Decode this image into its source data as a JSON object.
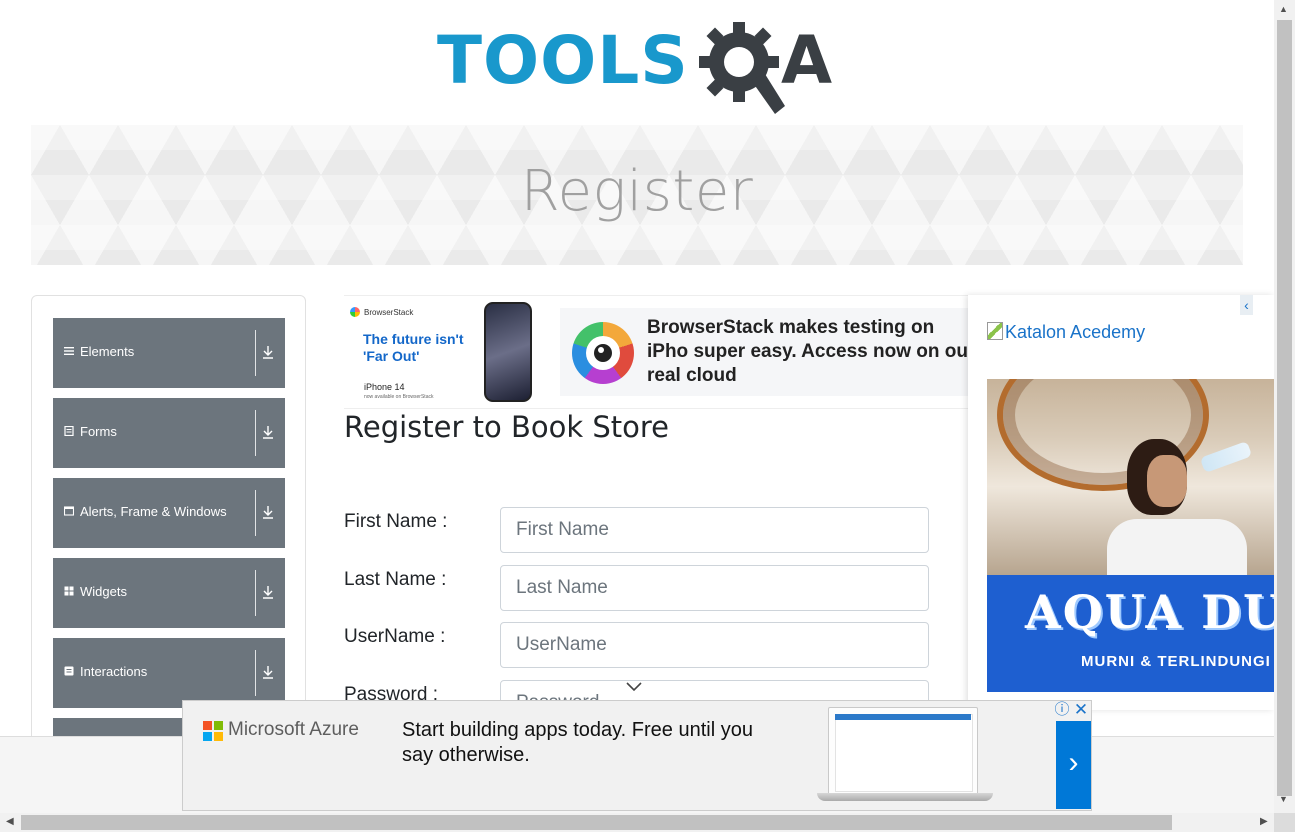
{
  "logo": {
    "text_blue": "TOOLS",
    "text_dark": "A"
  },
  "page_title": "Register",
  "sidebar": {
    "groups": [
      {
        "label": "Elements",
        "icon": "hamburger-icon"
      },
      {
        "label": "Forms",
        "icon": "form-icon"
      },
      {
        "label": "Alerts, Frame & Windows",
        "icon": "window-icon"
      },
      {
        "label": "Widgets",
        "icon": "widgets-icon"
      },
      {
        "label": "Interactions",
        "icon": "interactions-icon"
      }
    ]
  },
  "top_ad": {
    "brand": "BrowserStack",
    "tagline": "The future isn't 'Far Out'",
    "product": "iPhone 14",
    "small_print": "now available on BrowserStack",
    "message": "BrowserStack makes testing on iPho super easy. Access now on our real cloud"
  },
  "form": {
    "heading": "Register to Book Store",
    "fields": [
      {
        "label": "First Name :",
        "placeholder": "First Name"
      },
      {
        "label": "Last Name :",
        "placeholder": "Last Name"
      },
      {
        "label": "UserName :",
        "placeholder": "UserName"
      },
      {
        "label": "Password :",
        "placeholder": "Password"
      }
    ]
  },
  "right_ad": {
    "link_text": "Katalon Acedemy",
    "brand": "AQUA DUI",
    "sub": "MURNI & TERLINDUNGI"
  },
  "bottom_ad": {
    "brand": "Microsoft Azure",
    "text": "Start building apps today. Free until you say otherwise.",
    "next": "›",
    "info": "ⓘ",
    "close": "✕"
  },
  "colors": {
    "accent_blue": "#1998cc",
    "menu_gray": "#6c757d",
    "azure_blue": "#0078d7"
  }
}
